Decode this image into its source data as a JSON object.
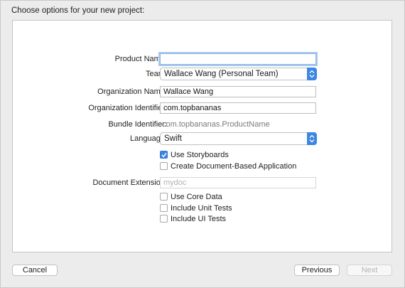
{
  "header": {
    "title": "Choose options for your new project:"
  },
  "form": {
    "product_name": {
      "label": "Product Name:",
      "value": ""
    },
    "team": {
      "label": "Team:",
      "value": "Wallace Wang (Personal Team)"
    },
    "organization_name": {
      "label": "Organization Name:",
      "value": "Wallace Wang"
    },
    "organization_identifier": {
      "label": "Organization Identifier:",
      "value": "com.topbananas"
    },
    "bundle_identifier": {
      "label": "Bundle Identifier:",
      "value": "com.topbananas.ProductName"
    },
    "language": {
      "label": "Language:",
      "value": "Swift"
    },
    "use_storyboards": {
      "label": "Use Storyboards",
      "checked": true
    },
    "create_document_based": {
      "label": "Create Document-Based Application",
      "checked": false
    },
    "document_extension": {
      "label": "Document Extension:",
      "placeholder": "mydoc"
    },
    "use_core_data": {
      "label": "Use Core Data",
      "checked": false
    },
    "include_unit_tests": {
      "label": "Include Unit Tests",
      "checked": false
    },
    "include_ui_tests": {
      "label": "Include UI Tests",
      "checked": false
    }
  },
  "footer": {
    "cancel_label": "Cancel",
    "previous_label": "Previous",
    "next_label": "Next"
  },
  "colors": {
    "accent": "#3d87e0",
    "focus_ring": "#a9c9f0",
    "window_bg": "#ececec"
  }
}
